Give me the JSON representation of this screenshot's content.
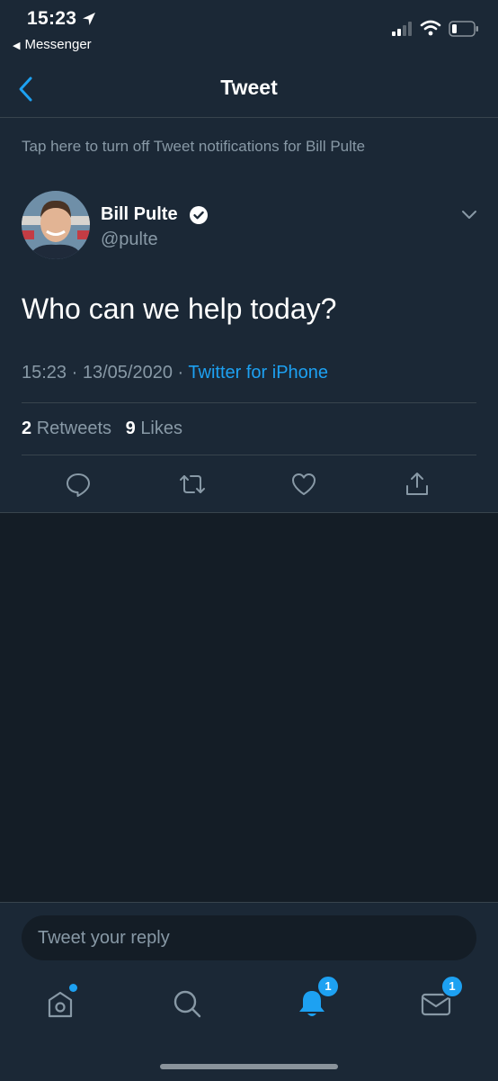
{
  "status_bar": {
    "time": "15:23",
    "back_app": "Messenger",
    "icons": [
      "location-arrow-icon",
      "signal-icon",
      "wifi-icon",
      "battery-icon"
    ]
  },
  "header": {
    "title": "Tweet",
    "back_icon": "chevron-left-icon"
  },
  "notification_banner": "Tap here to turn off Tweet notifications for Bill Pulte",
  "tweet": {
    "author_name": "Bill Pulte",
    "author_handle": "@pulte",
    "verified": true,
    "text": "Who can we help today?",
    "time": "15:23",
    "separator1": "·",
    "date": "13/05/2020",
    "separator2": "·",
    "source": "Twitter for iPhone",
    "retweets_count": "2",
    "retweets_label": "Retweets",
    "likes_count": "9",
    "likes_label": "Likes"
  },
  "actions": [
    "reply-icon",
    "retweet-icon",
    "like-icon",
    "share-icon"
  ],
  "reply": {
    "placeholder": "Tweet your reply"
  },
  "tab_bar": {
    "notifications_badge": "1",
    "messages_badge": "1"
  },
  "colors": {
    "background": "#141d26",
    "surface": "#1b2836",
    "accent": "#1da1f2",
    "secondary_text": "#8899a6",
    "divider": "#38444d"
  }
}
